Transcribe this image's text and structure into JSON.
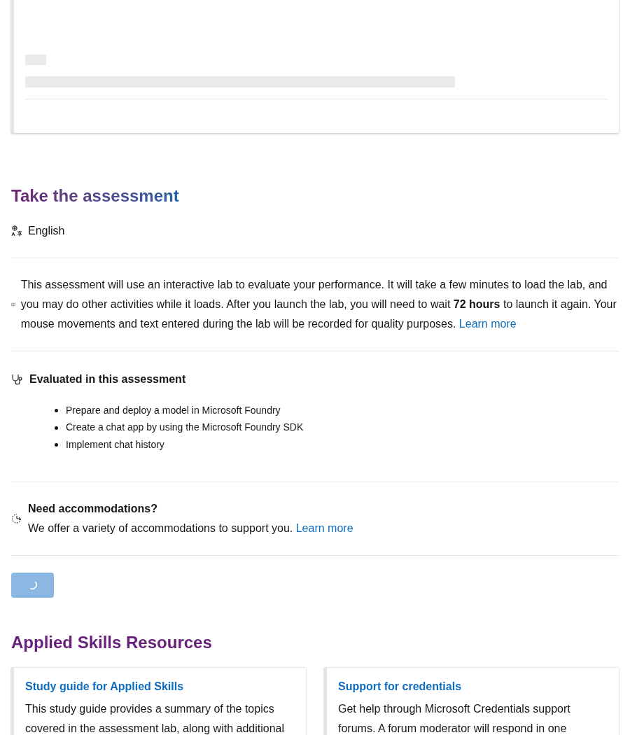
{
  "assessment": {
    "title": "Take the assessment",
    "language": "English",
    "lab_notice": {
      "text": "This assessment will use an interactive lab to evaluate your performance. It will take a few minutes to load the lab, and you may do other activities while it loads. After you launch the lab, you will need to wait **72 hours** to launch it again. Your mouse movements and text entered during the lab will be recorded for quality purposes.",
      "link": "Learn more"
    },
    "evaluated": {
      "heading": "Evaluated in this assessment",
      "items": [
        "Prepare and deploy a model in Microsoft Foundry",
        "Create a chat app by using the Microsoft Foundry SDK",
        "Implement chat history"
      ]
    },
    "accommodations": {
      "heading": "Need accommodations?",
      "text": "We offer a variety of accommodations to support you.",
      "link": "Learn more"
    },
    "launch_button": {
      "loading": true
    }
  },
  "resources": {
    "title": "Applied Skills Resources",
    "cards": [
      {
        "title": "Study guide for Applied Skills",
        "text": "This study guide provides a summary of the topics covered in the assessment lab, along with additional"
      },
      {
        "title": "Support for credentials",
        "text": "Get help through Microsoft Credentials support forums. A forum moderator will respond in one"
      }
    ]
  }
}
